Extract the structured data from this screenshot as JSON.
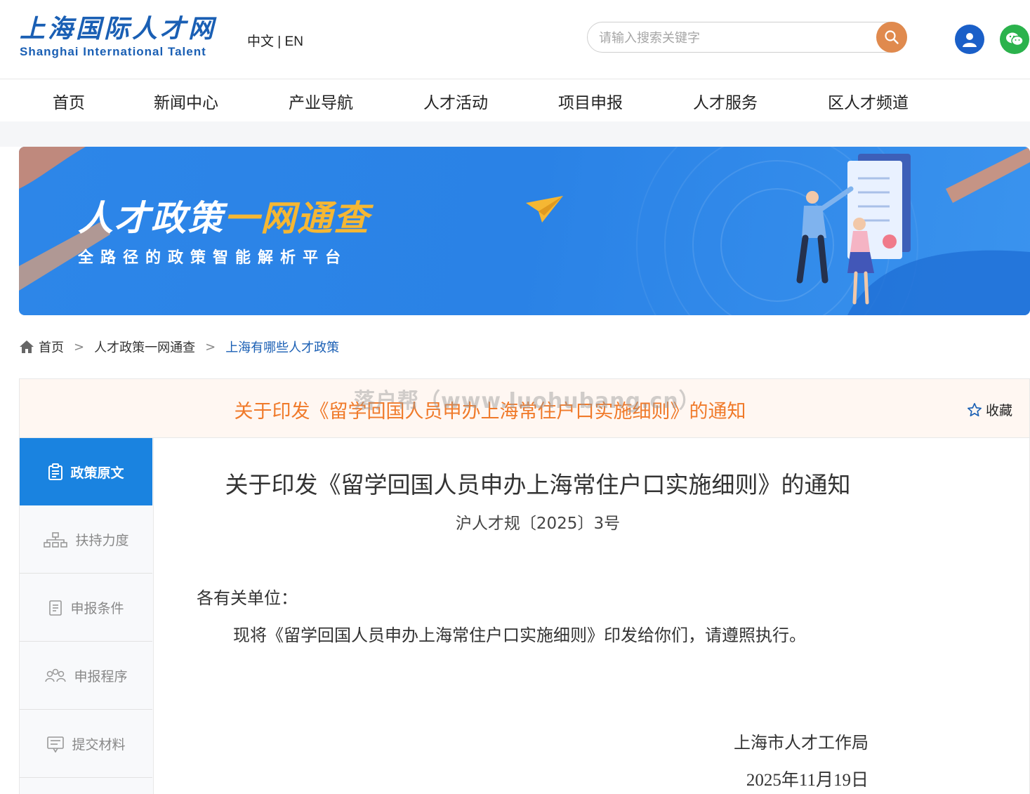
{
  "header": {
    "logo_cn": "上海国际人才网",
    "logo_en": "Shanghai International Talent",
    "lang_cn": "中文",
    "lang_sep": " | ",
    "lang_en": "EN",
    "search_placeholder": "请输入搜索关键字",
    "search_icon": "search-icon",
    "user_icon": "user-icon",
    "wechat_icon": "wechat-icon"
  },
  "nav": {
    "items": [
      "首页",
      "新闻中心",
      "产业导航",
      "人才活动",
      "项目申报",
      "人才服务",
      "区人才频道"
    ]
  },
  "banner": {
    "title_part1": "人才政策",
    "title_part2": "一网通查",
    "subtitle": "全路径的政策智能解析平台"
  },
  "breadcrumb": {
    "items": [
      "首页",
      "人才政策一网通查",
      "上海有哪些人才政策"
    ]
  },
  "title_bar": {
    "title": "关于印发《留学回国人员申办上海常住户口实施细则》的通知",
    "watermark": "落户帮（www.luohubang.cn）",
    "favorite": "收藏"
  },
  "sidebar": {
    "items": [
      "政策原文",
      "扶持力度",
      "申报条件",
      "申报程序",
      "提交材料"
    ]
  },
  "document": {
    "title": "关于印发《留学回国人员申办上海常住户口实施细则》的通知",
    "number": "沪人才规〔2025〕3号",
    "greeting": "各有关单位：",
    "body": "现将《留学回国人员申办上海常住户口实施细则》印发给你们，请遵照执行。",
    "issuer": "上海市人才工作局",
    "date": "2025年11月19日"
  },
  "colors": {
    "brand_blue": "#1a5fb4",
    "accent_orange": "#f07a2a",
    "sidebar_active": "#1a83e0",
    "wechat_green": "#2bb24c"
  }
}
